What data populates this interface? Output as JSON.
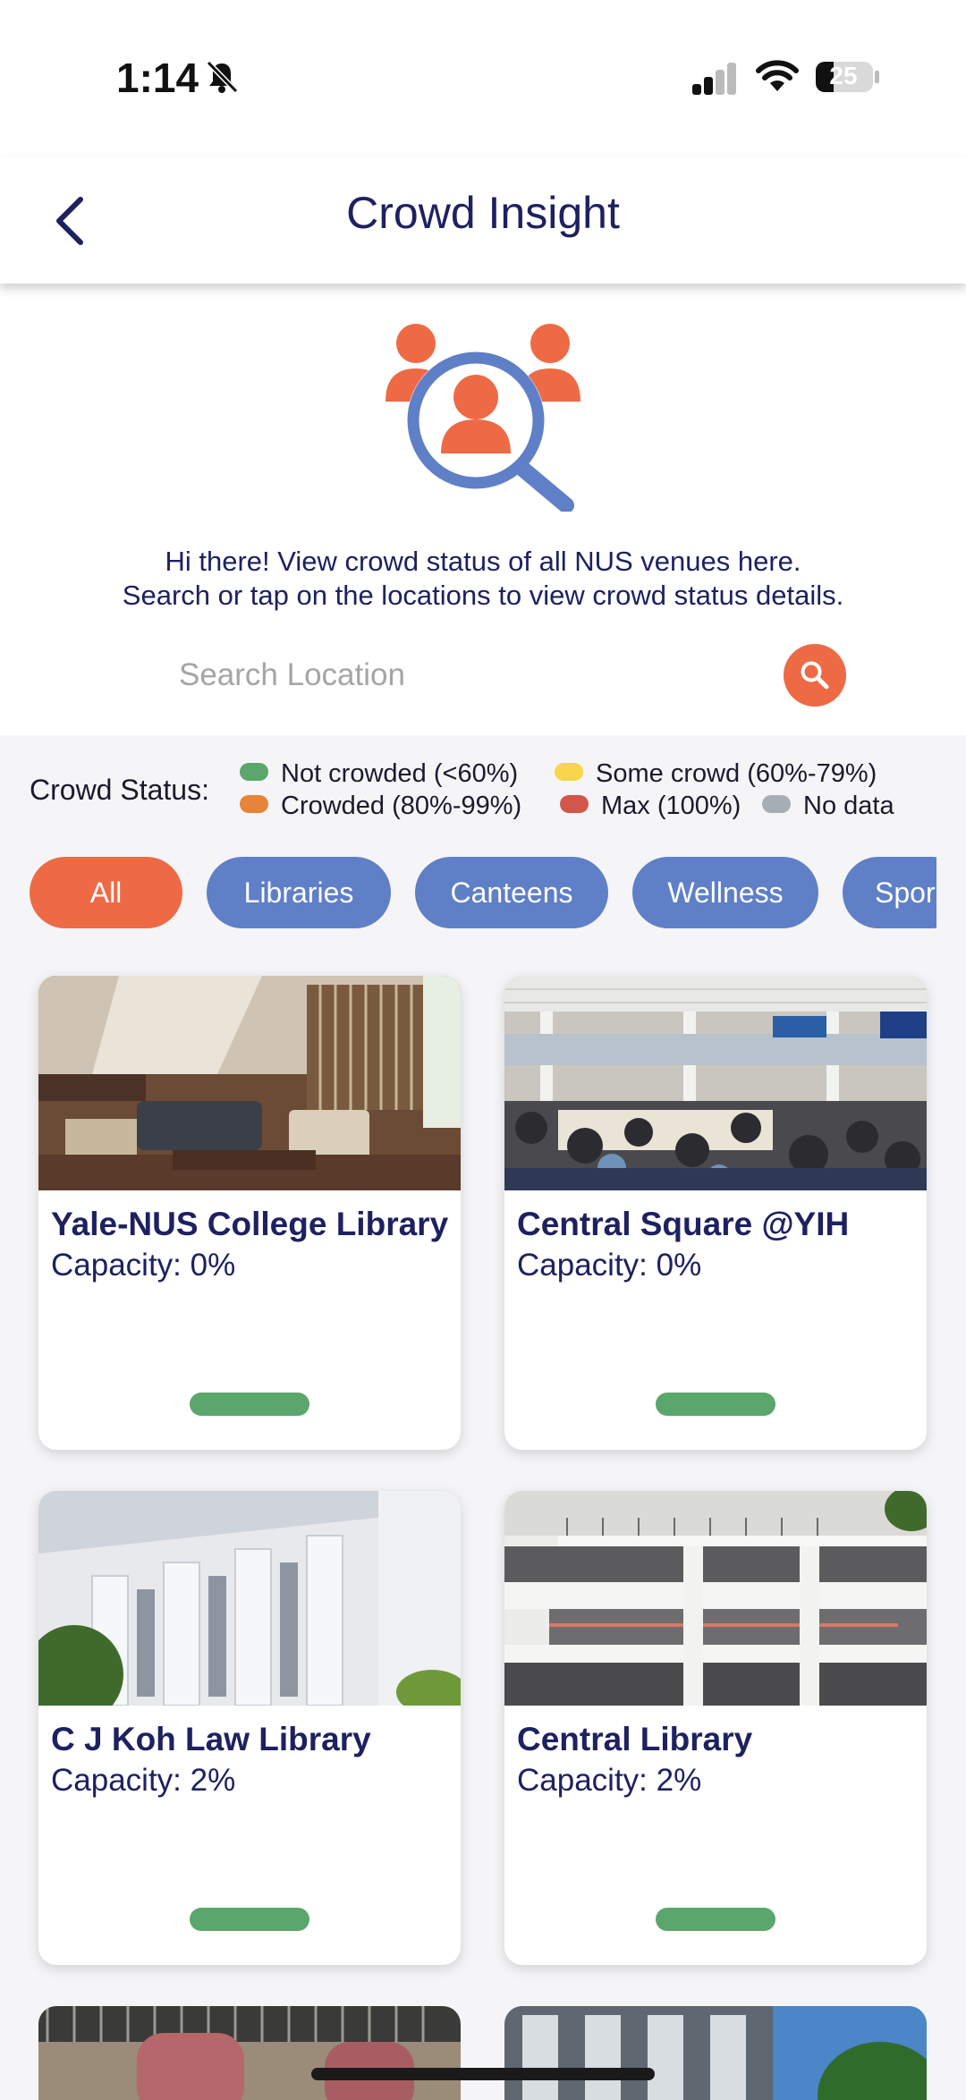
{
  "status_bar": {
    "time": "1:14",
    "battery": "25"
  },
  "header": {
    "title": "Crowd Insight",
    "back_icon": "chevron-left-icon"
  },
  "intro": {
    "line1": "Hi there! View crowd status of all NUS venues here.",
    "line2": "Search or tap on the locations to view crowd status details."
  },
  "search": {
    "placeholder": "Search Location",
    "value": "",
    "icon": "search-icon"
  },
  "legend": {
    "label": "Crowd Status:",
    "items": [
      {
        "label": "Not crowded (<60%)",
        "color": "#5aa66c"
      },
      {
        "label": "Some crowd (60%-79%)",
        "color": "#f7d64a"
      },
      {
        "label": "Crowded (80%-99%)",
        "color": "#e8843a"
      },
      {
        "label": "Max (100%)",
        "color": "#d2574a"
      },
      {
        "label": "No data",
        "color": "#a7aeb3"
      }
    ]
  },
  "filters": [
    {
      "label": "All",
      "active": true
    },
    {
      "label": "Libraries",
      "active": false
    },
    {
      "label": "Canteens",
      "active": false
    },
    {
      "label": "Wellness",
      "active": false
    },
    {
      "label": "Spor",
      "active": false
    }
  ],
  "venues": [
    {
      "name": "Yale-NUS College Library",
      "capacity": "Capacity: 0%",
      "status_color": "#5aa66c"
    },
    {
      "name": "Central Square @YIH",
      "capacity": "Capacity: 0%",
      "status_color": "#5aa66c"
    },
    {
      "name": "C J Koh Law Library",
      "capacity": "Capacity: 2%",
      "status_color": "#5aa66c"
    },
    {
      "name": "Central Library",
      "capacity": "Capacity: 2%",
      "status_color": "#5aa66c"
    }
  ],
  "colors": {
    "accent": "#ee6a45",
    "primary": "#5f7fc7",
    "text": "#1e2160"
  }
}
